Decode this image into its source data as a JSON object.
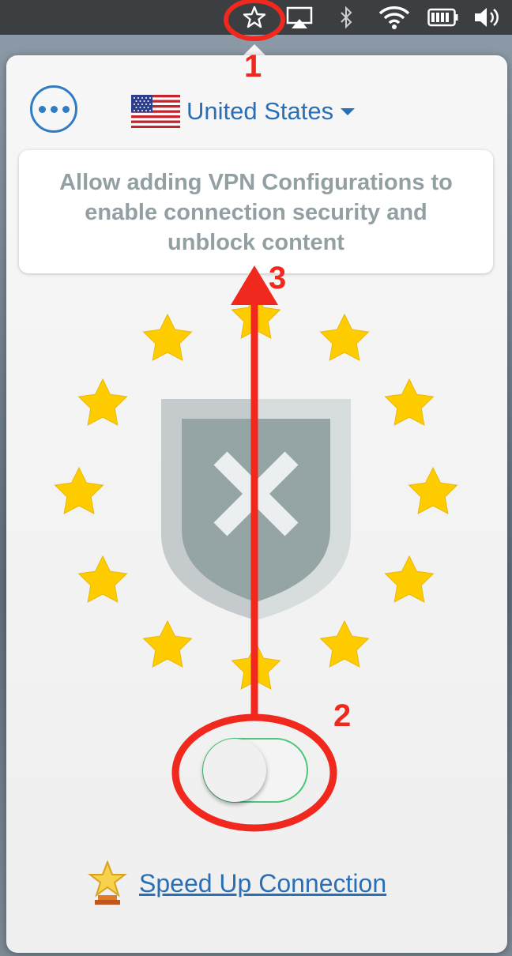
{
  "menubar": {
    "icons": [
      "star-outline-icon",
      "airplay-icon",
      "bluetooth-icon",
      "wifi-icon",
      "battery-icon",
      "volume-icon"
    ]
  },
  "popover": {
    "more_icon": "ellipsis-icon",
    "country": {
      "flag": "us-flag-icon",
      "name": "United States",
      "dropdown_icon": "caret-down-icon"
    },
    "message": "Allow adding VPN Configurations to enable connection security and unblock content",
    "status_icon": "shield-x-icon",
    "toggle_state": "off",
    "speed_up": {
      "icon": "trophy-icon",
      "label": "Speed Up Connection"
    }
  },
  "annotations": {
    "step1": "1",
    "step2": "2",
    "step3": "3"
  },
  "colors": {
    "accent": "#2a6fb5",
    "annotation_red": "#f0281e",
    "star_yellow": "#ffcc00",
    "shield_gray": "#95a5a6",
    "toggle_green": "#4cc77a"
  }
}
